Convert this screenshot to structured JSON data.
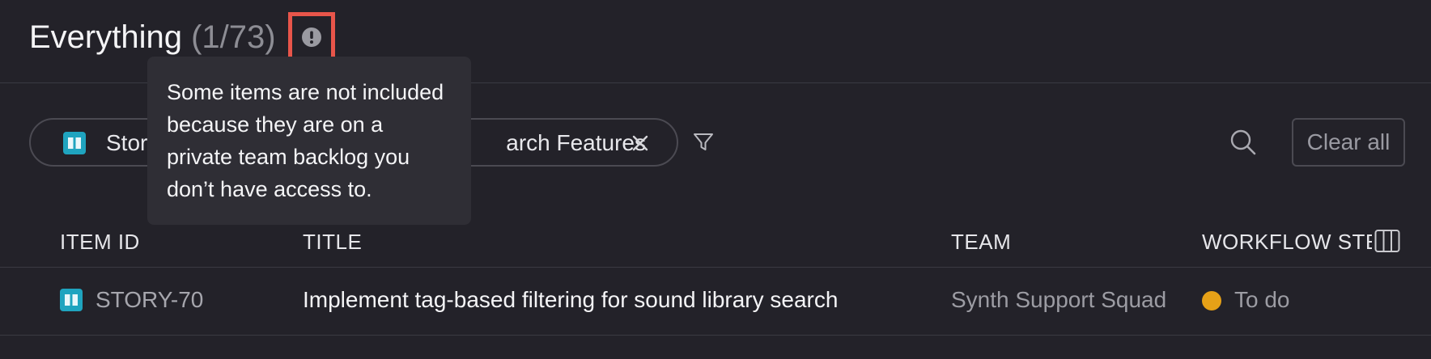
{
  "header": {
    "title": "Everything",
    "count": "(1/73)",
    "alert_icon": "exclamation-circle-icon"
  },
  "tooltip": {
    "text": "Some items are not included because they are on a private team backlog you don’t have access to."
  },
  "filters": {
    "pill_text_left": "Stor",
    "pill_text_right": "arch Features",
    "pill_icon": "story-book-icon",
    "remove_icon": "close-icon",
    "filter_icon": "filter-icon"
  },
  "toolbar": {
    "search_icon": "search-icon",
    "clear_all_label": "Clear all"
  },
  "table": {
    "columns": [
      "ITEM ID",
      "TITLE",
      "TEAM",
      "WORKFLOW STE"
    ],
    "columns_icon": "columns-icon",
    "rows": [
      {
        "id": "STORY-70",
        "title": "Implement tag-based filtering for sound library search",
        "team": "Synth Support Squad",
        "status": "To do"
      }
    ]
  },
  "colors": {
    "background": "#232229",
    "alert_outline": "#e8554a",
    "story_icon": "#1fa4bf",
    "status_todo": "#e6a117"
  }
}
